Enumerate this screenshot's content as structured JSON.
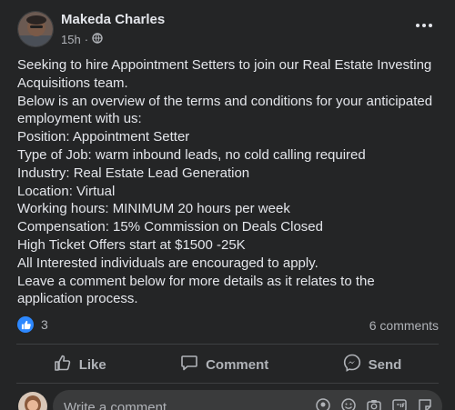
{
  "post": {
    "author": "Makeda Charles",
    "time": "15h",
    "audience_icon": "globe-icon",
    "more_icon": "more-options-icon",
    "lines": [
      "Seeking to hire Appointment Setters to join our Real Estate Investing",
      "Acquisitions team.",
      "Below is an overview of the terms and conditions for your anticipated",
      "employment with us:",
      "Position: Appointment Setter",
      "Type of Job: warm inbound leads, no cold calling required",
      "Industry: Real Estate Lead Generation",
      "Location: Virtual",
      "Working hours: MINIMUM 20 hours per week",
      "Compensation: 15% Commission on Deals Closed",
      "High Ticket Offers start at $1500 -25K",
      "All Interested individuals are encouraged to apply.",
      "Leave a comment below for more details as it relates to the",
      "application process."
    ]
  },
  "stats": {
    "reaction_count": "3",
    "comments": "6 comments"
  },
  "actions": {
    "like": "Like",
    "comment": "Comment",
    "send": "Send"
  },
  "composer": {
    "placeholder": "Write a comment..."
  },
  "colors": {
    "background": "#242526",
    "text": "#e4e6eb",
    "secondary": "#b0b3b8",
    "like_blue": "#2d88ff",
    "input_bg": "#3a3b3c"
  }
}
